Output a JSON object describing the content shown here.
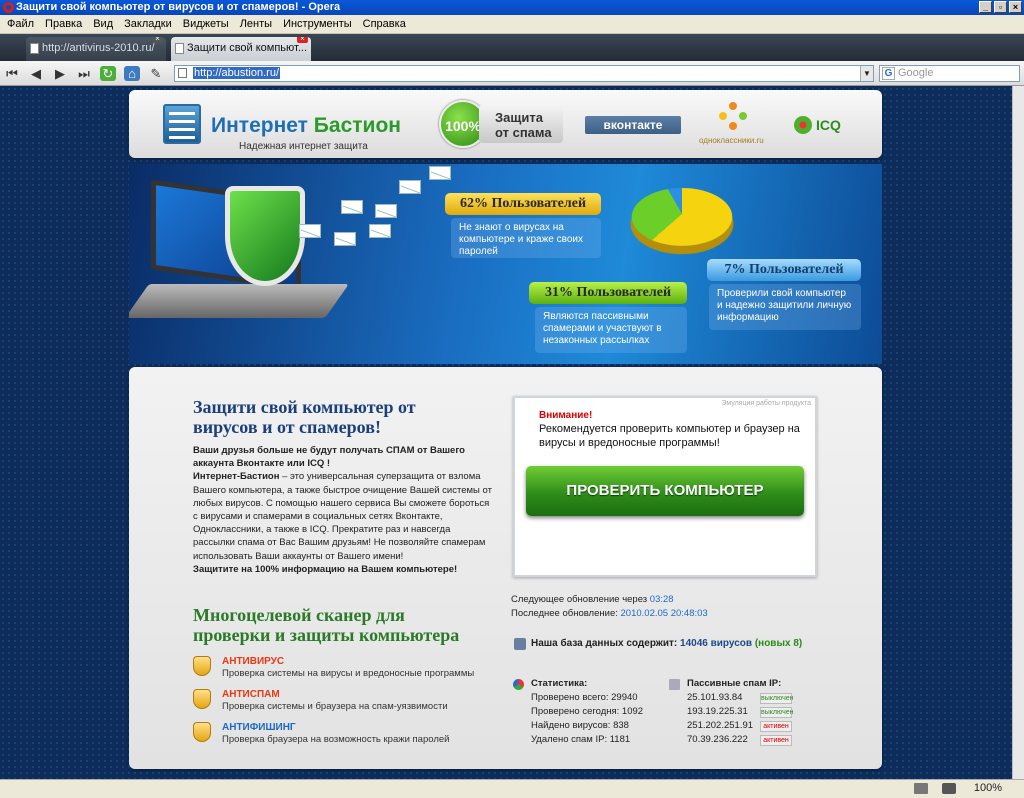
{
  "window": {
    "title": "Защити свой компьютер от вирусов и от спамеров! - Opera"
  },
  "menu": [
    "Файл",
    "Правка",
    "Вид",
    "Закладки",
    "Виджеты",
    "Ленты",
    "Инструменты",
    "Справка"
  ],
  "tabs": [
    {
      "label": "http://antivirus-2010.ru/"
    },
    {
      "label": "Защити свой компьют..."
    }
  ],
  "address": {
    "url": "http://abustion.ru/",
    "search_placeholder": "Google"
  },
  "status": {
    "zoom": "100%"
  },
  "header": {
    "logo_part1": "Интернет",
    "logo_part2": "Бастион",
    "tagline": "Надежная интернет защита",
    "badge": "100%",
    "spam_l1": "Защита",
    "spam_l2": "от спама",
    "vk": "вконтакте",
    "ok": "одноклассники.ru",
    "icq": "ICQ"
  },
  "banner": {
    "p62": {
      "pill": "62% Пользователей",
      "text": "Не знают о вирусах на компьютере и краже своих паролей"
    },
    "p31": {
      "pill": "31% Пользователей",
      "text": "Являются пассивными спамерами и участвуют в незаконных рассылках"
    },
    "p7": {
      "pill": "7% Пользователей",
      "text": "Проверили свой компьютер и надежно защитили личную информацию"
    }
  },
  "chart_data": {
    "type": "pie",
    "categories": [
      "62% Пользователей",
      "31% Пользователей",
      "7% Пользователей"
    ],
    "values": [
      62,
      31,
      7
    ],
    "colors": [
      "#f5d30e",
      "#6ccf29",
      "#2d8fe0"
    ]
  },
  "main": {
    "h1": "Защити свой компьютер от вирусов и от спамеров!",
    "intro_b1": "Ваши друзья больше не будут получать СПАМ от Вашего аккаунта Вконтакте или ICQ !",
    "intro_b2": "Интернет-Бастион",
    "intro_text": " – это универсальная суперзащита от взлома Вашего компьютера, а также быстрое очищение Вашей системы от любых вирусов. С помощью нашего сервиса Вы сможете бороться с вирусами и спамерами в социальных сетях Вконтакте, Одноклассники, а также в ICQ. Прекратите раз и навсегда рассылки спама от Вас Вашим друзьям! Не позволяйте спамерам использовать Ваши аккаунты от Вашего имени!",
    "intro_b3": "Защитите на 100% информацию на Вашем компьютере!",
    "h2": "Многоцелевой сканер для проверки и защиты компьютера",
    "features": [
      {
        "title": "АНТИВИРУС",
        "desc": "Проверка системы на вирусы и вредоносные программы",
        "color": "#e53a12"
      },
      {
        "title": "АНТИСПАМ",
        "desc": "Проверка системы и браузера на спам-уязвимости",
        "color": "#e53a12"
      },
      {
        "title": "АНТИФИШИНГ",
        "desc": "Проверка браузера на возможность кражи паролей",
        "color": "#1c6ac7"
      }
    ]
  },
  "scanner": {
    "emulation": "Эмуляция работы продукта",
    "warn": "Внимание!",
    "warn_text": "Рекомендуется проверить компьютер и браузер на вирусы и вредоносные программы!",
    "button": "ПРОВЕРИТЬ КОМПЬЮТЕР"
  },
  "updates": {
    "next_label": "Следующее обновление через ",
    "next_value": "03:28",
    "last_label": "Последнее обновление: ",
    "last_value": "2010.02.05 20:48:03"
  },
  "db": {
    "label": "Наша база данных содержит: ",
    "value": "14046 вирусов",
    "new": "(новых 8)"
  },
  "stats": {
    "title": "Статистика:",
    "rows": [
      "Проверено всего: 29940",
      "Проверено сегодня: 1092",
      "Найдено вирусов: 838",
      "Удалено спам IP: 1181"
    ]
  },
  "ips": {
    "title": "Пассивные спам IP:",
    "rows": [
      {
        "ip": "25.101.93.84",
        "status": "выключен"
      },
      {
        "ip": "193.19.225.31",
        "status": "выключен"
      },
      {
        "ip": "251.202.251.91",
        "status": "активен"
      },
      {
        "ip": "70.39.236.222",
        "status": "активен"
      }
    ]
  }
}
